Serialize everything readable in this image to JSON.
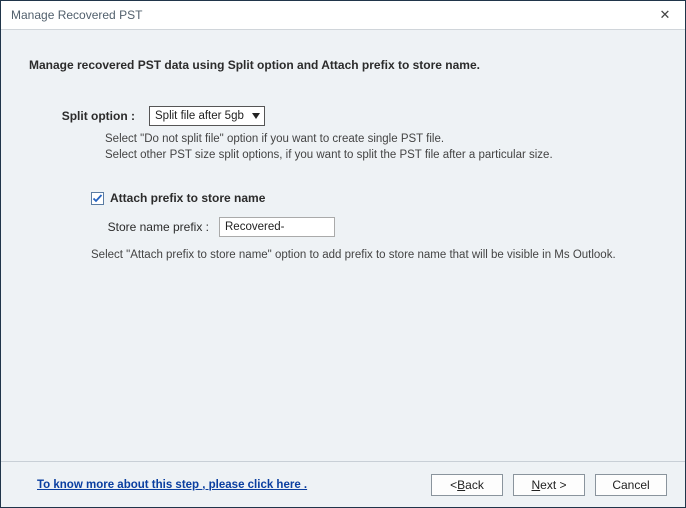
{
  "window": {
    "title": "Manage Recovered PST"
  },
  "heading": "Manage recovered PST data using Split option and Attach prefix to store name.",
  "split": {
    "label": "Split option :",
    "value": "Split file after 5gb",
    "help1": "Select \"Do not split file\" option if you want to create single PST file.",
    "help2": "Select other PST size split options, if you want to split the PST file after a particular size."
  },
  "prefix": {
    "checkboxLabel": "Attach prefix to store name",
    "checked": true,
    "fieldLabel": "Store name prefix :",
    "value": "Recovered-",
    "help": "Select \"Attach prefix to store name\" option to add prefix to store name that will be visible in Ms Outlook."
  },
  "footer": {
    "link": "To know more about this step , please click here .",
    "back": "< Back",
    "nextPrefix": "N",
    "nextRest": "ext >",
    "cancel": "Cancel",
    "backPrefix": "< ",
    "backLetter": "B",
    "backRest": "ack"
  }
}
